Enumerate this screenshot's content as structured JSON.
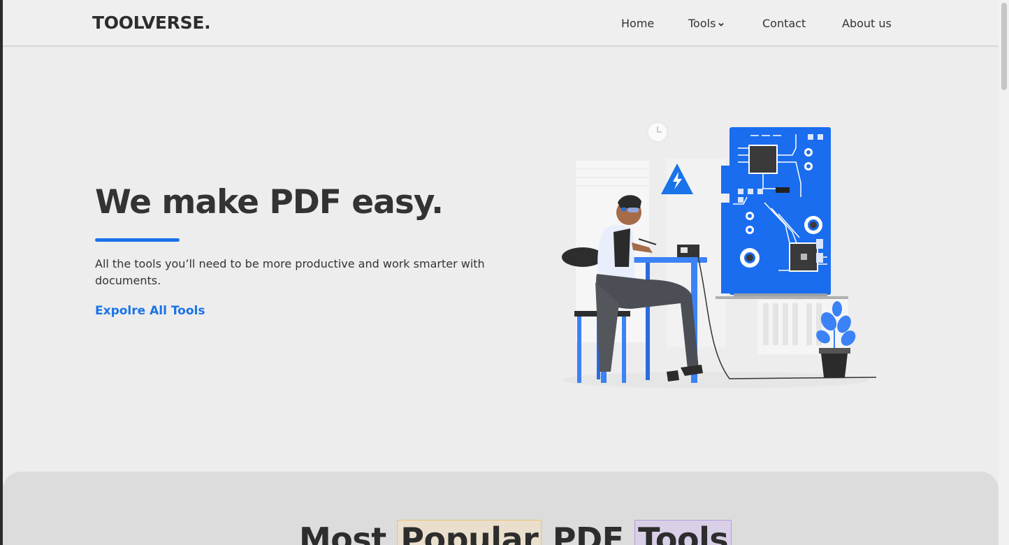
{
  "header": {
    "logo": "TOOLVERSE.",
    "nav": {
      "home": "Home",
      "tools": "Tools",
      "contact": "Contact",
      "about": "About us"
    }
  },
  "hero": {
    "title": "We make PDF easy.",
    "description": "All the tools you’ll need to be more productive and work smarter with documents.",
    "cta": "Expolre All Tools"
  },
  "section": {
    "title_part1": "Most",
    "title_highlight1": "Popular",
    "title_part2": "PDF",
    "title_highlight2": "Tools"
  },
  "colors": {
    "accent": "#1a73e8",
    "background": "#ededed",
    "text": "#333333"
  }
}
